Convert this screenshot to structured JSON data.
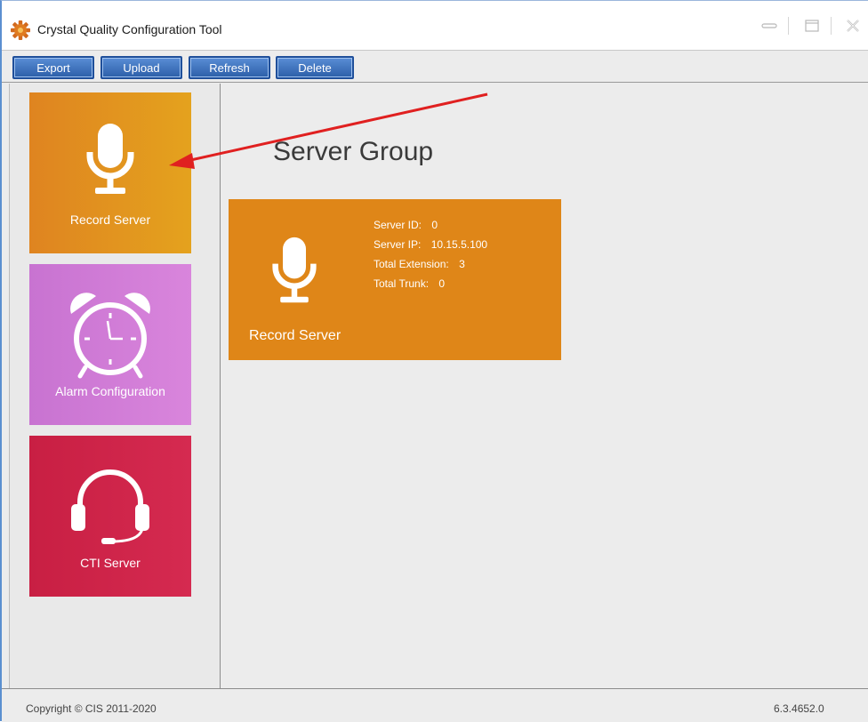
{
  "window": {
    "title": "Crystal Quality Configuration Tool"
  },
  "toolbar": {
    "export_label": "Export",
    "upload_label": "Upload",
    "refresh_label": "Refresh",
    "delete_label": "Delete"
  },
  "sidebar": {
    "tiles": [
      {
        "label": "Record Server",
        "icon": "microphone-icon",
        "color": "#df8420"
      },
      {
        "label": "Alarm Configuration",
        "icon": "alarm-clock-icon",
        "color": "#d079d6"
      },
      {
        "label": "CTI Server",
        "icon": "headset-icon",
        "color": "#cc2448"
      }
    ]
  },
  "main": {
    "title": "Server Group",
    "card": {
      "name": "Record Server",
      "icon": "microphone-icon",
      "color": "#df8618",
      "server_id_label": "Server ID:",
      "server_id": "0",
      "server_ip_label": "Server IP:",
      "server_ip": "10.15.5.100",
      "total_extension_label": "Total Extension:",
      "total_extension": "3",
      "total_trunk_label": "Total Trunk:",
      "total_trunk": "0"
    }
  },
  "status": {
    "copyright": "Copyright © CIS 2011-2020",
    "version": "6.3.4652.0"
  },
  "annotation": {
    "arrow_color": "#e02020"
  }
}
